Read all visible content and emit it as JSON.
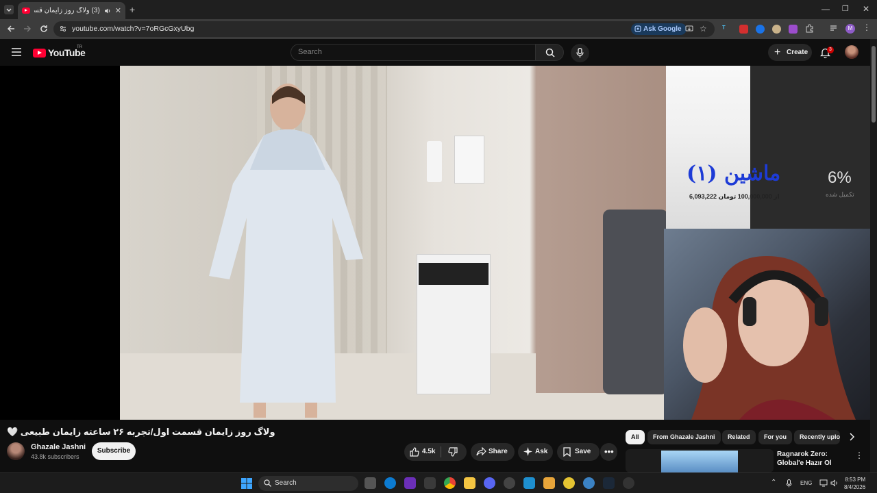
{
  "browser": {
    "tab_title": "(3) ولاگ روز زایمان قسمت او",
    "url": "youtube.com/watch?v=7oRGcGxyUbg",
    "ask_google": "Ask Google",
    "profile_initial": "M"
  },
  "youtube": {
    "logo_text": "YouTube",
    "region": "TR",
    "search_placeholder": "Search",
    "create_label": "Create",
    "notification_count": "3"
  },
  "overlay": {
    "goal_title": "ماشین (۱)",
    "amount_text": "6,093,222 از 100,000,000 تومان",
    "percent": "6%",
    "percent_label": "تکمیل شده"
  },
  "video": {
    "title": "ولاگ روز زایمان قسمت اول/تجربه ۲۶ ساعته زایمان طبیعی 🤍",
    "channel_name": "Ghazale Jashni",
    "subscribers": "43.8k subscribers",
    "subscribe_label": "Subscribe",
    "likes": "4.5k",
    "share_label": "Share",
    "ask_label": "Ask",
    "save_label": "Save"
  },
  "chips": [
    "All",
    "From Ghazale Jashni",
    "Related",
    "For you",
    "Recently uplo"
  ],
  "recommendation": {
    "title": "Ragnarok Zero: Global'e Hazır Ol"
  },
  "taskbar": {
    "search_label": "Search",
    "language": "ENG",
    "time": "8:53 PM",
    "date": "8/4/2026"
  },
  "colors": {
    "youtube_red": "#ff0033",
    "background": "#0f0f0f",
    "overlay_title": "#1d3bd6"
  }
}
